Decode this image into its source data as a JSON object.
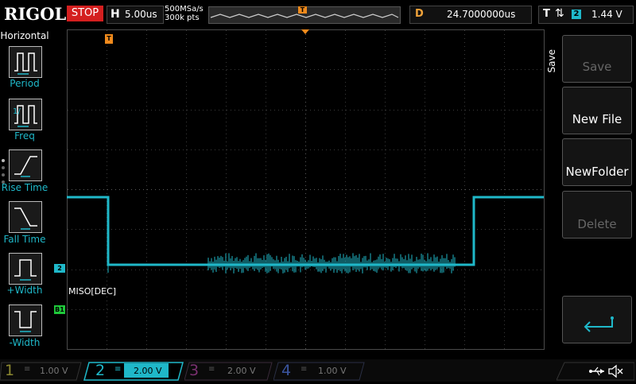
{
  "top": {
    "brand": "RIGOL",
    "run_state": "STOP",
    "horizontal_letter": "H",
    "timebase": "5.00us",
    "sample_rate": "500MSa/s",
    "memory_depth": "300k pts",
    "delay_letter": "D",
    "delay_value": "24.7000000us",
    "trigger_letter": "T",
    "trigger_source": "2",
    "trigger_level": "1.44 V",
    "trigger_marker": "T"
  },
  "left_menu": {
    "title": "Horizontal",
    "items": [
      {
        "label": "Period",
        "icon": "period-icon"
      },
      {
        "label": "Freq",
        "icon": "freq-icon"
      },
      {
        "label": "Rise Time",
        "icon": "rise-time-icon"
      },
      {
        "label": "Fall Time",
        "icon": "fall-time-icon"
      },
      {
        "label": "+Width",
        "icon": "positive-width-icon"
      },
      {
        "label": "-Width",
        "icon": "negative-width-icon"
      }
    ]
  },
  "waveform": {
    "decoder_label": "MISO[DEC]",
    "channel_marker": "2",
    "bus_marker": "B1",
    "trigger_marker": "T",
    "color": "#1fb8c9"
  },
  "right_menu": {
    "title": "Save",
    "buttons": [
      {
        "label": "Save",
        "enabled": false
      },
      {
        "label": "New File",
        "enabled": true
      },
      {
        "label": "NewFolder",
        "enabled": true
      },
      {
        "label": "Delete",
        "enabled": false
      }
    ],
    "return_icon": "return-arrow-icon"
  },
  "channels": [
    {
      "num": "1",
      "scale": "1.00 V",
      "color": "#c9c23a",
      "active": false
    },
    {
      "num": "2",
      "scale": "2.00 V",
      "color": "#1fb8c9",
      "active": true
    },
    {
      "num": "3",
      "scale": "2.00 V",
      "color": "#c03aa8",
      "active": false
    },
    {
      "num": "4",
      "scale": "1.00 V",
      "color": "#3a66c9",
      "active": false
    }
  ],
  "status_icons": [
    "usb-icon",
    "speaker-mute-icon"
  ]
}
